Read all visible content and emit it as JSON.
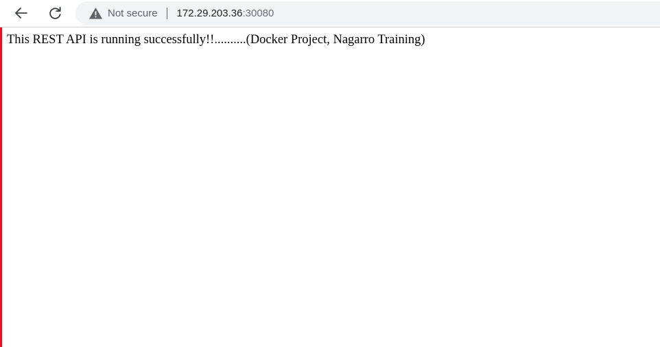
{
  "browser": {
    "security_label": "Not secure",
    "url_host": "172.29.203.36",
    "url_port": ":30080",
    "icons": {
      "back": "back-arrow-icon",
      "reload": "reload-icon",
      "security": "warning-triangle-icon"
    },
    "colors": {
      "left_accent": "#e81123",
      "omnibox_bg": "#f1f3f4"
    }
  },
  "page": {
    "message": "This REST API is running successfully!!..........(Docker Project, Nagarro Training)"
  }
}
